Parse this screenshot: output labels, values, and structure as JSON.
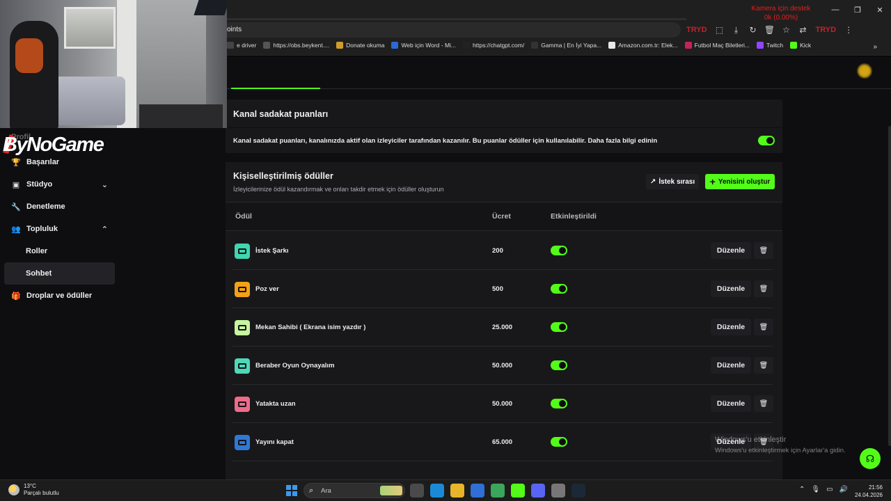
{
  "browser": {
    "camera_badge": "Kamera için destek",
    "camera_badge_sub": "0k (0.00%)",
    "url_text": "oints",
    "toolbar_red_left": "TRYD",
    "toolbar_red_right": "TRYD",
    "bookmarks": [
      {
        "label": "e driver",
        "icon": "bookmark-icon",
        "color": "#444444"
      },
      {
        "label": "https://obs.beykent....",
        "icon": "globe-icon",
        "color": "#555555"
      },
      {
        "label": "Donate okuma",
        "icon": "donate-icon",
        "color": "#d19c2a"
      },
      {
        "label": "Web için Word - Mi...",
        "icon": "word-icon",
        "color": "#2b6ad6"
      },
      {
        "label": "https://chatgpt.com/",
        "icon": "chatgpt-icon",
        "color": "#222222"
      },
      {
        "label": "Gamma | En İyi Yapa...",
        "icon": "gamma-icon",
        "color": "#333333"
      },
      {
        "label": "Amazon.com.tr: Elek...",
        "icon": "amazon-icon",
        "color": "#e8e8e8"
      },
      {
        "label": "Futbol Maç Biletleri...",
        "icon": "ticket-icon",
        "color": "#c2245a"
      },
      {
        "label": "Twitch",
        "icon": "twitch-icon",
        "color": "#9146ff"
      },
      {
        "label": "Kick",
        "icon": "kick-icon",
        "color": "#53fc18"
      }
    ]
  },
  "sidebar": {
    "hidden_item": "Profil",
    "items": [
      {
        "label": "Başarılar",
        "icon": "trophy-icon",
        "glyph": "🏆"
      },
      {
        "label": "Stüdyo",
        "icon": "studio-icon",
        "glyph": "▣",
        "chevron": "⌄"
      },
      {
        "label": "Denetleme",
        "icon": "wrench-icon",
        "glyph": "🔧"
      },
      {
        "label": "Topluluk",
        "icon": "community-icon",
        "glyph": "👥",
        "chevron": "⌃"
      },
      {
        "label": "Roller",
        "sub": true
      },
      {
        "label": "Sohbet",
        "sub": true,
        "active": true
      },
      {
        "label": "Droplar ve ödüller",
        "icon": "gift-icon",
        "glyph": "🎁"
      }
    ]
  },
  "loyalty": {
    "title": "Kanal sadakat puanları",
    "description": "Kanal sadakat puanları, kanalınızda aktif olan izleyiciler tarafından kazanılır. Bu puanlar ödüller için kullanılabilir. Daha fazla bilgi edinin",
    "enabled": true
  },
  "rewards": {
    "title": "Kişiselleştirilmiş ödüller",
    "subtitle": "İzleyicilerinize ödül kazandırmak ve onları takdir etmek için ödüller oluşturun",
    "queue_button": "İstek sırası",
    "create_button": "Yenisini oluştur",
    "columns": {
      "reward": "Ödül",
      "cost": "Ücret",
      "enabled": "Etkinleştirildi"
    },
    "edit_label": "Düzenle",
    "items": [
      {
        "name": "İstek Şarkı",
        "cost": "200",
        "enabled": true,
        "color": "#3fd6b0"
      },
      {
        "name": "Poz ver",
        "cost": "500",
        "enabled": true,
        "color": "#f3a116"
      },
      {
        "name": "Mekan Sahibi ( Ekrana isim yazdır )",
        "cost": "25.000",
        "enabled": true,
        "color": "#c8f5a0"
      },
      {
        "name": "Beraber Oyun Oynayalım",
        "cost": "50.000",
        "enabled": true,
        "color": "#4fd8b7"
      },
      {
        "name": "Yatakta uzan",
        "cost": "50.000",
        "enabled": true,
        "color": "#ef6b8a"
      },
      {
        "name": "Yayını kapat",
        "cost": "65.000",
        "enabled": true,
        "color": "#2f79d6"
      }
    ]
  },
  "overlay": {
    "logo_text": "ByNoGame",
    "activate_title": "Windows'u etkinleştir",
    "activate_sub": "Windows'u etkinleştirmek için Ayarlar'a gidin."
  },
  "taskbar": {
    "temperature": "13°C",
    "weather": "Parçalı bulutlu",
    "search_placeholder": "Ara",
    "time": "21:56",
    "date": "24.04.2026",
    "apps": [
      {
        "icon": "file-explorer-icon",
        "color": "#4a4a4a"
      },
      {
        "icon": "edge-icon",
        "color": "#1a8ad6"
      },
      {
        "icon": "folder-icon",
        "color": "#e8b42a"
      },
      {
        "icon": "mail-icon",
        "color": "#2f6fd6"
      },
      {
        "icon": "chrome-icon",
        "color": "#3ba55c"
      },
      {
        "icon": "kick-app-icon",
        "color": "#53fc18"
      },
      {
        "icon": "discord-icon",
        "color": "#5865f2"
      },
      {
        "icon": "app-icon",
        "color": "#777777"
      },
      {
        "icon": "steam-icon",
        "color": "#1b2838"
      }
    ]
  }
}
